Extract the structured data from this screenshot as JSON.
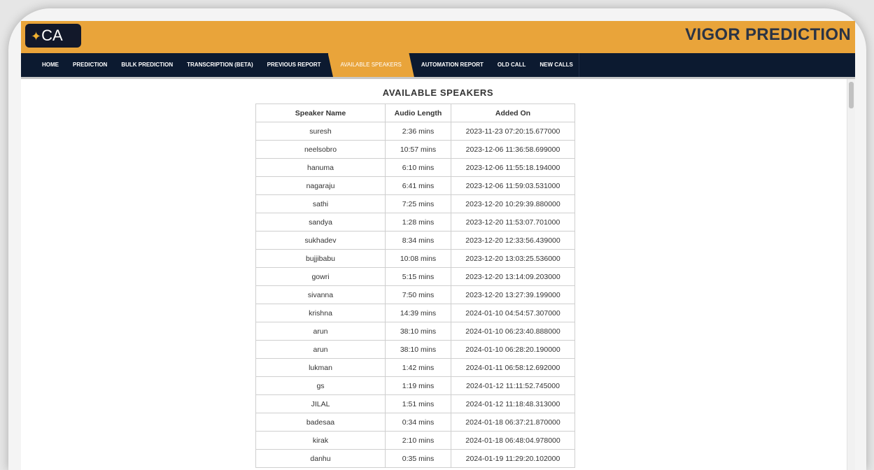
{
  "header": {
    "logo_text": "CA",
    "title": "VIGOR PREDICTION"
  },
  "nav": [
    {
      "label": "HOME",
      "active": false
    },
    {
      "label": "PREDICTION",
      "active": false
    },
    {
      "label": "BULK PREDICTION",
      "active": false
    },
    {
      "label": "TRANSCRIPTION (BETA)",
      "active": false
    },
    {
      "label": "PREVIOUS REPORT",
      "active": false
    },
    {
      "label": "AVAILABLE SPEAKERS",
      "active": true
    },
    {
      "label": "AUTOMATION REPORT",
      "active": false
    },
    {
      "label": "OLD CALL",
      "active": false
    },
    {
      "label": "NEW CALLS",
      "active": false
    }
  ],
  "page": {
    "title": "AVAILABLE SPEAKERS"
  },
  "table": {
    "columns": [
      "Speaker Name",
      "Audio Length",
      "Added On"
    ],
    "rows": [
      [
        "suresh",
        "2:36 mins",
        "2023-11-23 07:20:15.677000"
      ],
      [
        "neelsobro",
        "10:57 mins",
        "2023-12-06 11:36:58.699000"
      ],
      [
        "hanuma",
        "6:10 mins",
        "2023-12-06 11:55:18.194000"
      ],
      [
        "nagaraju",
        "6:41 mins",
        "2023-12-06 11:59:03.531000"
      ],
      [
        "sathi",
        "7:25 mins",
        "2023-12-20 10:29:39.880000"
      ],
      [
        "sandya",
        "1:28 mins",
        "2023-12-20 11:53:07.701000"
      ],
      [
        "sukhadev",
        "8:34 mins",
        "2023-12-20 12:33:56.439000"
      ],
      [
        "bujjibabu",
        "10:08 mins",
        "2023-12-20 13:03:25.536000"
      ],
      [
        "gowri",
        "5:15 mins",
        "2023-12-20 13:14:09.203000"
      ],
      [
        "sivanna",
        "7:50 mins",
        "2023-12-20 13:27:39.199000"
      ],
      [
        "krishna",
        "14:39 mins",
        "2024-01-10 04:54:57.307000"
      ],
      [
        "arun",
        "38:10 mins",
        "2024-01-10 06:23:40.888000"
      ],
      [
        "arun",
        "38:10 mins",
        "2024-01-10 06:28:20.190000"
      ],
      [
        "lukman",
        "1:42 mins",
        "2024-01-11 06:58:12.692000"
      ],
      [
        "gs",
        "1:19 mins",
        "2024-01-12 11:11:52.745000"
      ],
      [
        "JILAL",
        "1:51 mins",
        "2024-01-12 11:18:48.313000"
      ],
      [
        "badesaa",
        "0:34 mins",
        "2024-01-18 06:37:21.870000"
      ],
      [
        "kirak",
        "2:10 mins",
        "2024-01-18 06:48:04.978000"
      ],
      [
        "danhu",
        "0:35 mins",
        "2024-01-19 11:29:20.102000"
      ]
    ]
  },
  "colors": {
    "header_bg": "#e9a43a",
    "nav_bg": "#0c1a30",
    "title_text": "#2b3445"
  }
}
